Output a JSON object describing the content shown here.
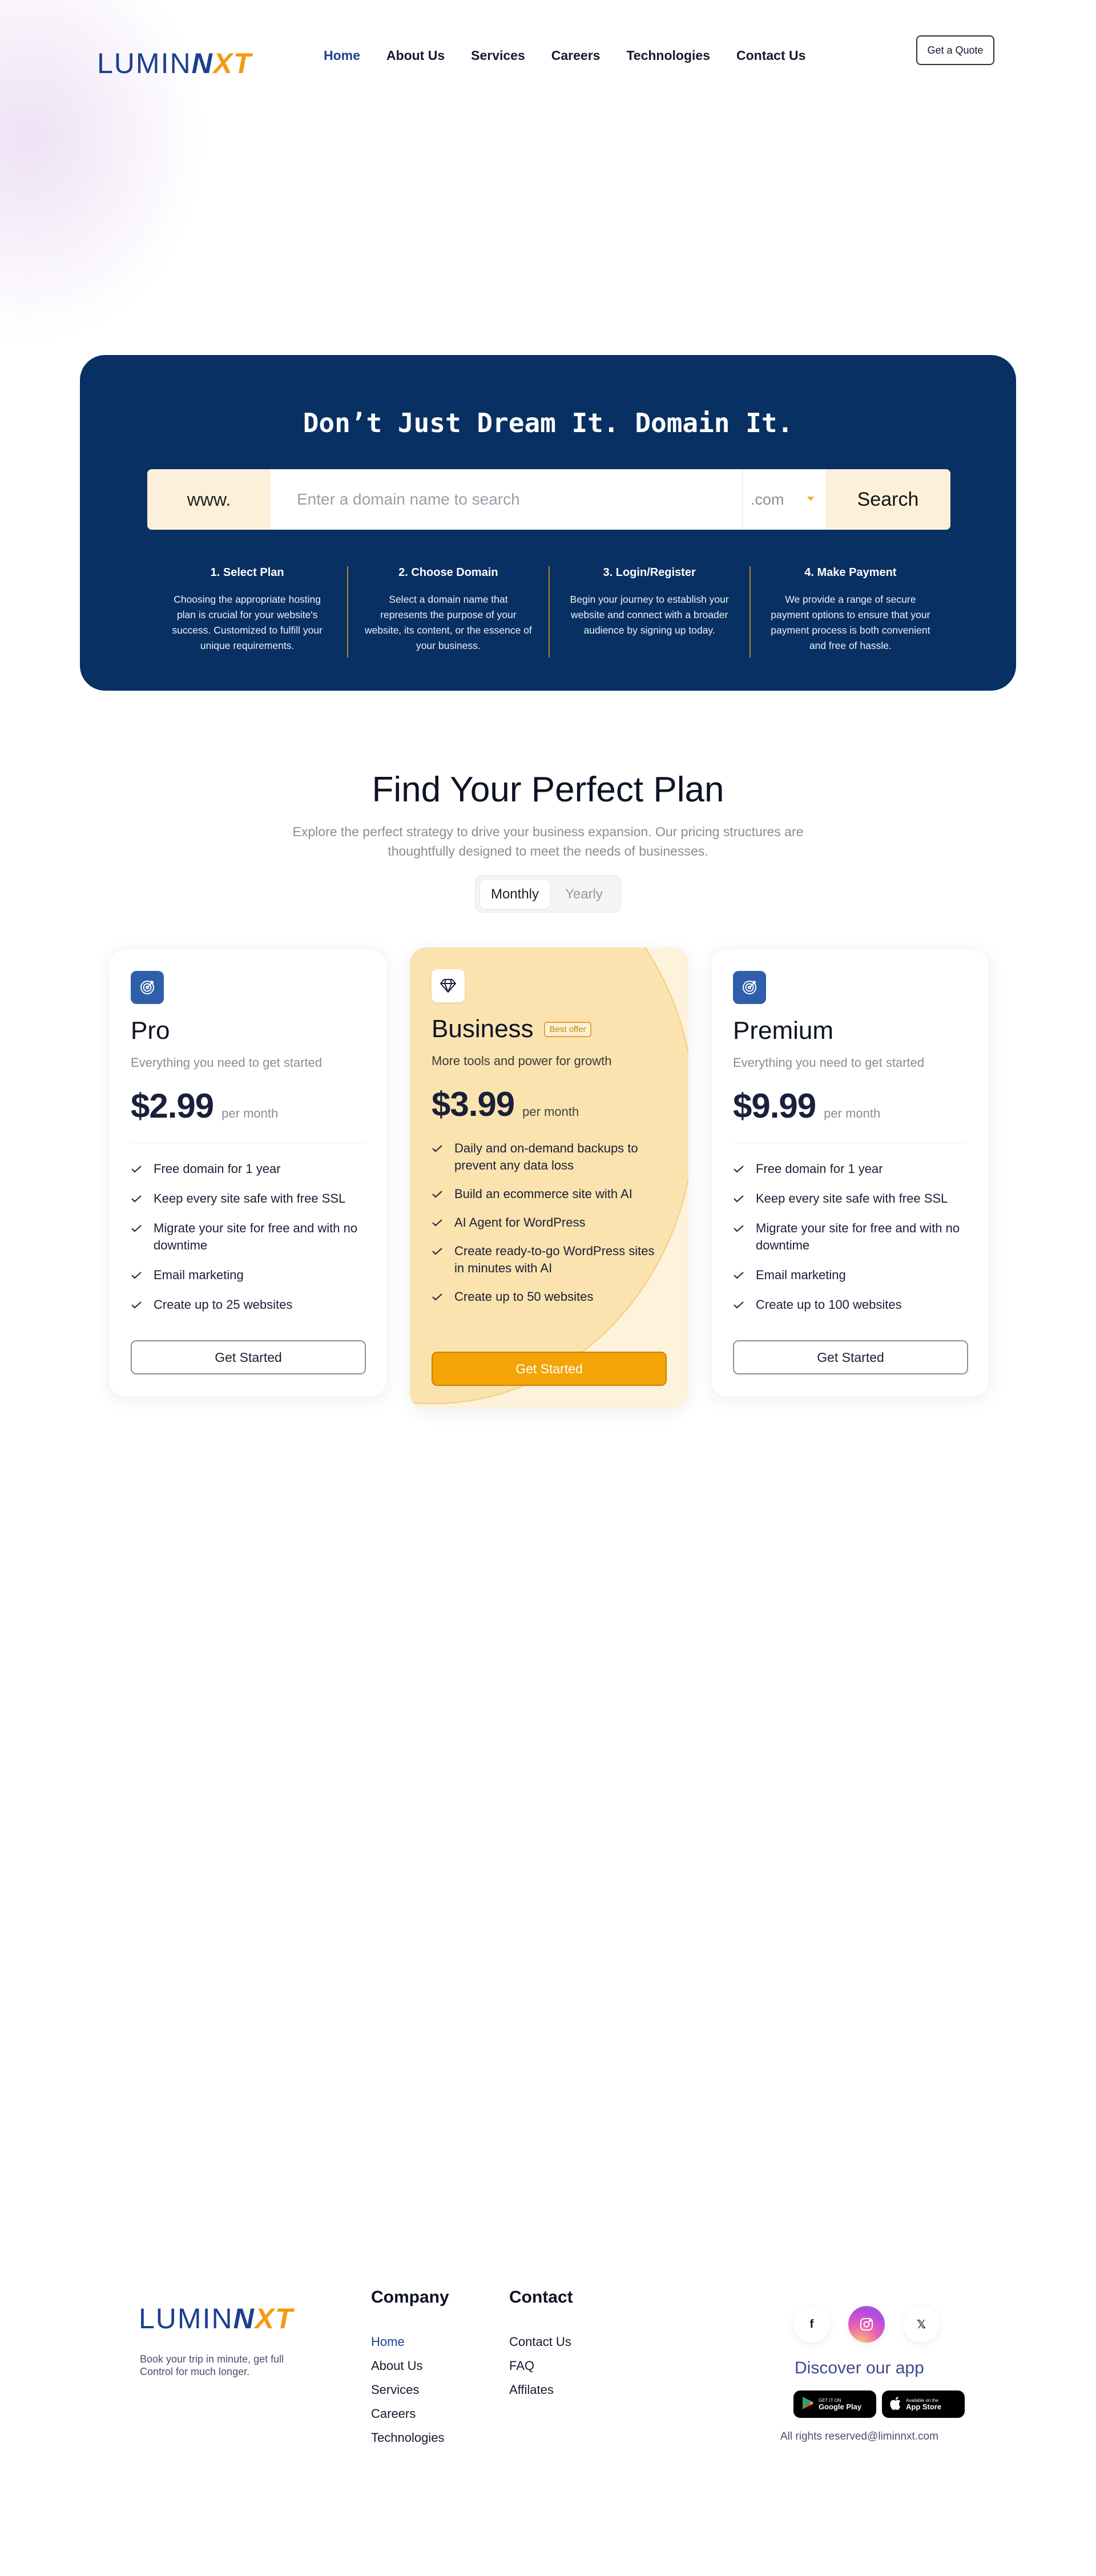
{
  "header": {
    "logo": {
      "part1": "LUMIN",
      "part2": "N",
      "part3": "XT"
    },
    "nav": [
      "Home",
      "About Us",
      "Services",
      "Careers",
      "Technologies",
      "Contact Us"
    ],
    "quote_label": "Get a Quote"
  },
  "domain": {
    "title": "Don’t Just Dream It. Domain It.",
    "prefix": "www.",
    "placeholder": "Enter a domain name to search",
    "tld": ".com",
    "search_label": "Search",
    "steps": [
      {
        "title": "1. Select Plan",
        "text": "Choosing the appropriate hosting plan is crucial for your website's success. Customized to fulfill your unique requirements."
      },
      {
        "title": "2. Choose Domain",
        "text": "Select a domain name that represents the purpose of your website, its content, or the essence of your business."
      },
      {
        "title": "3. Login/Register",
        "text": "Begin your journey to establish your website and connect with a broader audience by signing up today."
      },
      {
        "title": "4. Make Payment",
        "text": "We provide a range of secure payment options to ensure that your payment process is both convenient and free of hassle."
      }
    ]
  },
  "plans": {
    "title": "Find Your Perfect Plan",
    "subtitle": "Explore the perfect strategy to drive your business expansion. Our pricing structures are thoughtfully designed to meet the needs of businesses.",
    "billing": {
      "monthly": "Monthly",
      "yearly": "Yearly",
      "selected": "Monthly"
    },
    "cards": [
      {
        "name": "Pro",
        "icon": "target-icon",
        "desc": "Everything you need to get started",
        "price": "$2.99",
        "per": "per month",
        "features": [
          "Free domain for 1 year",
          "Keep every site safe with free SSL",
          "Migrate your site for free and with no downtime",
          "Email marketing",
          "Create up to 25 websites"
        ],
        "cta": "Get Started"
      },
      {
        "name": "Business",
        "icon": "diamond-icon",
        "badge": "Best offer",
        "desc": "More tools and power for growth",
        "price": "$3.99",
        "per": "per month",
        "features": [
          "Daily and on-demand backups to prevent any data loss",
          "Build an ecommerce site with AI",
          "AI Agent for WordPress",
          "Create ready-to-go WordPress sites in minutes with AI",
          "Create up to 50 websites"
        ],
        "cta": "Get Started"
      },
      {
        "name": "Premium",
        "icon": "target-icon",
        "desc": "Everything you need to get started",
        "price": "$9.99",
        "per": "per month",
        "features": [
          "Free domain for 1 year",
          "Keep every site safe with free SSL",
          "Migrate your site for free and with no downtime",
          "Email marketing",
          "Create up to 100 websites"
        ],
        "cta": "Get Started"
      }
    ]
  },
  "footer": {
    "tagline": "Book your trip in minute, get full Control for much longer.",
    "company": {
      "title": "Company",
      "links": [
        "Home",
        "About Us",
        "Services",
        "Careers",
        "Technologies"
      ]
    },
    "contact": {
      "title": "Contact",
      "links": [
        "Contact Us",
        "FAQ",
        "Affilates"
      ]
    },
    "socials": [
      {
        "name": "facebook-icon",
        "glyph": "f"
      },
      {
        "name": "instagram-icon",
        "glyph": ""
      },
      {
        "name": "twitter-icon",
        "glyph": "𝕏"
      }
    ],
    "discover": "Discover our app",
    "stores": [
      {
        "small": "GET IT ON",
        "big": "Google Play",
        "icon": "google-play-icon"
      },
      {
        "small": "Available on the",
        "big": "App Store",
        "icon": "apple-icon"
      }
    ],
    "rights": "All rights reserved@liminnxt.com"
  },
  "colors": {
    "navy": "#083062",
    "brand_blue": "#1d3f8f",
    "brand_orange": "#f39a16",
    "accent_gold": "#f4a405",
    "cream": "#fdf0da"
  }
}
